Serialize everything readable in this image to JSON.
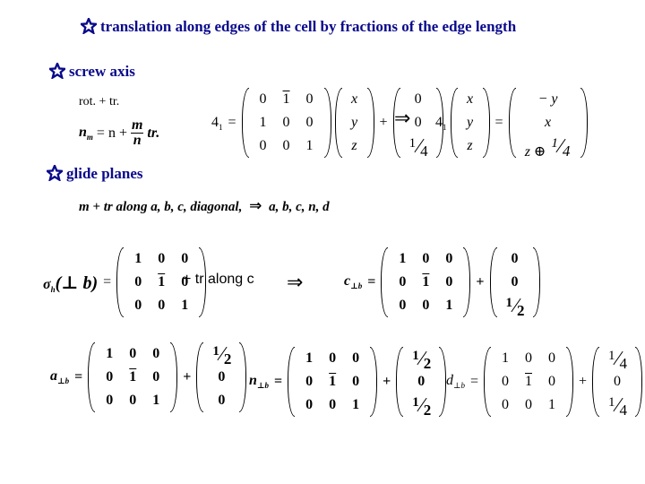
{
  "headings": {
    "translation": "translation along edges of the cell by fractions of the edge length",
    "screw": "screw axis",
    "glide": "glide planes"
  },
  "icons": {
    "bullet": "star-icon",
    "implies": "double-right-arrow"
  },
  "colors": {
    "heading": "#0a0a8c",
    "text": "#000000",
    "background": "#ffffff"
  },
  "screw": {
    "rot_tr_label": "rot. + tr.",
    "formula": {
      "lhs": "n",
      "lhs_sub": "m",
      "eq": "= n +",
      "num": "m",
      "den": "n",
      "tail": "tr."
    },
    "op_label": "4",
    "op_sub": "1",
    "eq": "=",
    "plus": "+",
    "implies": "⇒",
    "rotation_matrix": [
      [
        "0",
        "1̄",
        "0"
      ],
      [
        "1",
        "0",
        "0"
      ],
      [
        "0",
        "0",
        "1"
      ]
    ],
    "vector": [
      "x",
      "y",
      "z"
    ],
    "translation": [
      "0",
      "0",
      "1/4"
    ],
    "result_vector": [
      "x",
      "y",
      "z"
    ],
    "result": [
      "− y",
      "x",
      "z ⊕ 1/4"
    ],
    "result_frac": {
      "num": "1",
      "den": "4"
    },
    "result_prefix": "z ⊕"
  },
  "glide": {
    "description": "m + tr along a, b, c, diagonal,",
    "implies": "⇒",
    "result_list": "a, b, c, n, d",
    "sigma": {
      "symbol": "σ",
      "sub": "h",
      "arg": "(⊥ b)",
      "eq": "="
    },
    "mirror_matrix": [
      [
        "1",
        "0",
        "0"
      ],
      [
        "0",
        "1̄",
        "0"
      ],
      [
        "0",
        "0",
        "1"
      ]
    ],
    "plus_tr_label": "+ tr along c",
    "ops": [
      {
        "name": "c",
        "sub": "⊥b",
        "eq": "=",
        "plus": "+",
        "matrix": [
          [
            "1",
            "0",
            "0"
          ],
          [
            "0",
            "1̄",
            "0"
          ],
          [
            "0",
            "0",
            "1"
          ]
        ],
        "translation": [
          "0",
          "0",
          "1/2"
        ]
      },
      {
        "name": "a",
        "sub": "⊥b",
        "eq": "=",
        "plus": "+",
        "matrix": [
          [
            "1",
            "0",
            "0"
          ],
          [
            "0",
            "1̄",
            "0"
          ],
          [
            "0",
            "0",
            "1"
          ]
        ],
        "translation": [
          "1/2",
          "0",
          "0"
        ]
      },
      {
        "name": "n",
        "sub": "⊥b",
        "eq": "=",
        "plus": "+",
        "matrix": [
          [
            "1",
            "0",
            "0"
          ],
          [
            "0",
            "1̄",
            "0"
          ],
          [
            "0",
            "0",
            "1"
          ]
        ],
        "translation": [
          "1/2",
          "0",
          "1/2"
        ]
      },
      {
        "name": "d",
        "sub": "⊥b",
        "eq": "=",
        "plus": "+",
        "matrix": [
          [
            "1",
            "0",
            "0"
          ],
          [
            "0",
            "1̄",
            "0"
          ],
          [
            "0",
            "0",
            "1"
          ]
        ],
        "translation": [
          "1/4",
          "0",
          "1/4"
        ]
      }
    ]
  }
}
